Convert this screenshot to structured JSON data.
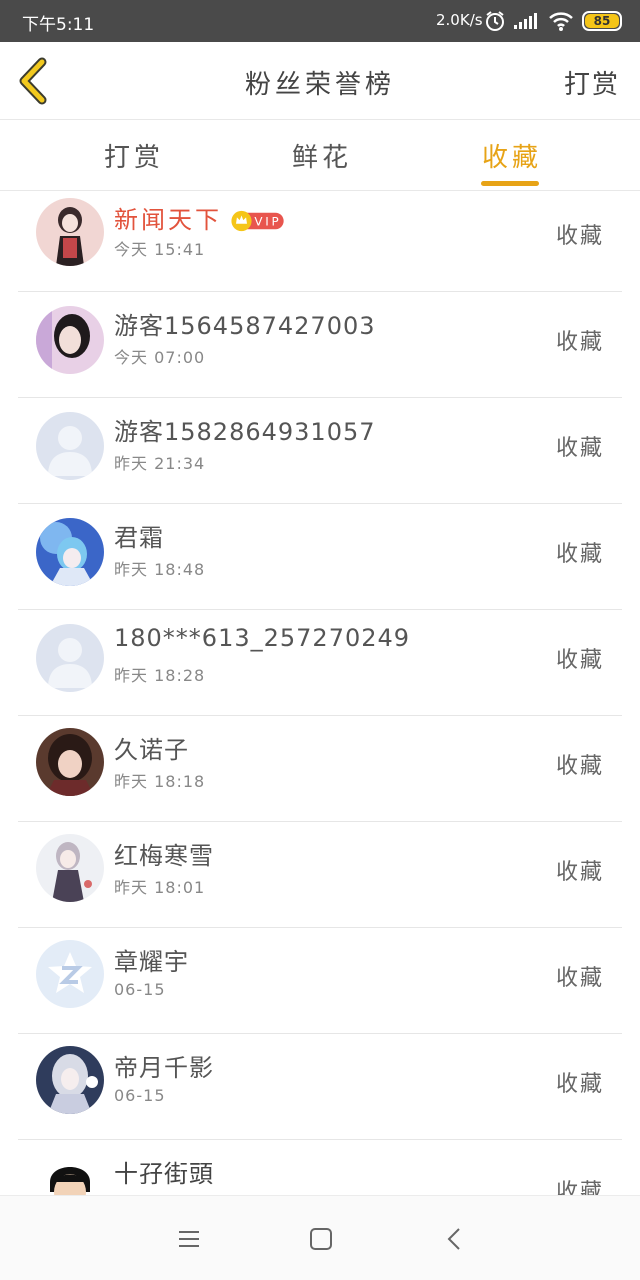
{
  "status_bar": {
    "time": "下午5:11",
    "net_speed": "2.0K/s",
    "battery": "85",
    "icons": [
      "alarm-icon",
      "signal-icon",
      "wifi-icon",
      "battery-icon"
    ]
  },
  "nav": {
    "back_icon": "chevron-left-icon",
    "title": "粉丝荣誉榜",
    "right_label": "打赏"
  },
  "tabs": [
    {
      "label": "打赏",
      "active": false
    },
    {
      "label": "鲜花",
      "active": false
    },
    {
      "label": "收藏",
      "active": true
    }
  ],
  "colors": {
    "accent": "#e7a316",
    "vip_name": "#e2533c",
    "vip_badge": "#e8554e"
  },
  "list": [
    {
      "name": "新闻天下",
      "time": "今天 15:41",
      "action": "收藏",
      "vip": true,
      "vip_label": "VIP",
      "avatar": "anime-girl-avatar"
    },
    {
      "name": "游客1564587427003",
      "time": "今天 07:00",
      "action": "收藏",
      "vip": false,
      "avatar": "photo-avatar"
    },
    {
      "name": "游客1582864931057",
      "time": "昨天 21:34",
      "action": "收藏",
      "vip": false,
      "avatar": "default-user-avatar"
    },
    {
      "name": "君霜",
      "time": "昨天 18:48",
      "action": "收藏",
      "vip": false,
      "avatar": "anime-blue-avatar"
    },
    {
      "name": "180***613_257270249",
      "time": "昨天 18:28",
      "action": "收藏",
      "vip": false,
      "avatar": "default-user-avatar"
    },
    {
      "name": "久诺子",
      "time": "昨天 18:18",
      "action": "收藏",
      "vip": false,
      "avatar": "anime-dark-avatar"
    },
    {
      "name": "红梅寒雪",
      "time": "昨天 18:01",
      "action": "收藏",
      "vip": false,
      "avatar": "anime-white-avatar"
    },
    {
      "name": "章耀宇",
      "time": "06-15",
      "action": "收藏",
      "vip": false,
      "avatar": "qq-avatar"
    },
    {
      "name": "帝月千影",
      "time": "06-15",
      "action": "收藏",
      "vip": false,
      "avatar": "anime-silver-avatar"
    },
    {
      "name": "十孖街頭",
      "time": "",
      "action": "收藏",
      "vip": false,
      "avatar": "cartoon-boy-avatar"
    }
  ],
  "bottom_nav": [
    "menu-icon",
    "home-square-icon",
    "back-triangle-icon"
  ]
}
